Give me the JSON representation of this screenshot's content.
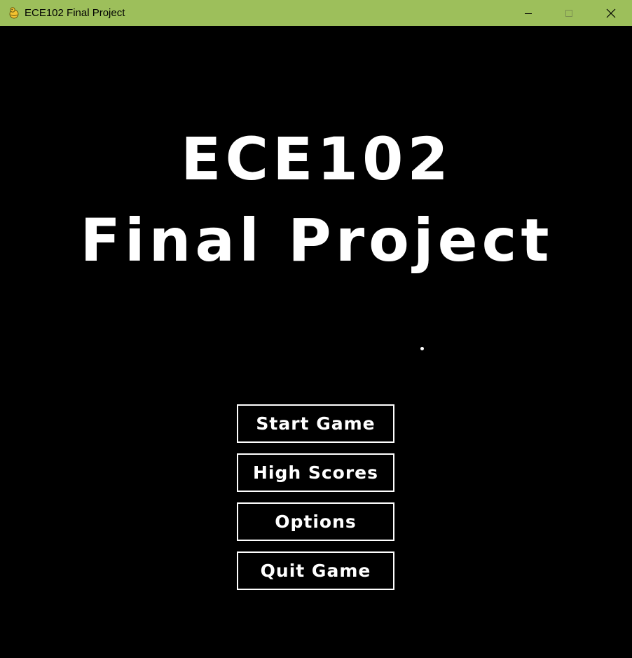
{
  "window": {
    "title": "ECE102 Final Project",
    "icon": "pygame-snake-icon",
    "titlebar_color": "#9dbf5b",
    "controls": {
      "minimize": "minimize-icon",
      "maximize": "maximize-icon",
      "close": "close-icon"
    }
  },
  "game": {
    "title_line_1": "ECE102",
    "title_line_2": "Final Project",
    "background_color": "#000000",
    "text_color": "#ffffff",
    "menu": {
      "start_label": "Start Game",
      "high_scores_label": "High Scores",
      "options_label": "Options",
      "quit_label": "Quit Game"
    }
  }
}
